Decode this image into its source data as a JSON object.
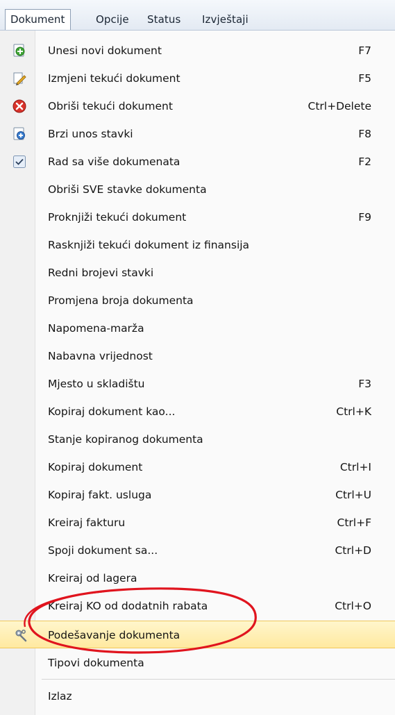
{
  "menubar": {
    "items": [
      {
        "label": "Dokument",
        "active": true
      },
      {
        "label": "Opcije",
        "active": false
      },
      {
        "label": "Status",
        "active": false
      },
      {
        "label": "Izvještaji",
        "active": false
      }
    ]
  },
  "menu": {
    "items": [
      {
        "label": "Unesi novi dokument",
        "shortcut": "F7",
        "icon": "add-document-icon"
      },
      {
        "label": "Izmjeni tekući dokument",
        "shortcut": "F5",
        "icon": "edit-pencil-icon"
      },
      {
        "label": "Obriši tekući dokument",
        "shortcut": "Ctrl+Delete",
        "icon": "delete-red-x-icon"
      },
      {
        "label": "Brzi unos stavki",
        "shortcut": "F8",
        "icon": "quick-add-document-icon"
      },
      {
        "label": "Rad sa više dokumenata",
        "shortcut": "F2",
        "icon": "checkmark-icon"
      },
      {
        "label": "Obriši SVE stavke dokumenta",
        "shortcut": ""
      },
      {
        "label": "Proknjiži tekući dokument",
        "shortcut": "F9"
      },
      {
        "label": "Rasknjiži tekući dokument iz finansija",
        "shortcut": ""
      },
      {
        "label": "Redni brojevi stavki",
        "shortcut": ""
      },
      {
        "label": "Promjena broja dokumenta",
        "shortcut": ""
      },
      {
        "label": "Napomena-marža",
        "shortcut": ""
      },
      {
        "label": "Nabavna vrijednost",
        "shortcut": ""
      },
      {
        "label": "Mjesto u skladištu",
        "shortcut": "F3"
      },
      {
        "label": "Kopiraj dokument kao...",
        "shortcut": "Ctrl+K"
      },
      {
        "label": "Stanje kopiranog dokumenta",
        "shortcut": ""
      },
      {
        "label": "Kopiraj dokument",
        "shortcut": "Ctrl+I"
      },
      {
        "label": "Kopiraj fakt. usluga",
        "shortcut": "Ctrl+U"
      },
      {
        "label": "Kreiraj fakturu",
        "shortcut": "Ctrl+F"
      },
      {
        "label": "Spoji dokument sa...",
        "shortcut": "Ctrl+D"
      },
      {
        "label": "Kreiraj od lagera",
        "shortcut": ""
      },
      {
        "label": "Kreiraj KO od dodatnih rabata",
        "shortcut": "Ctrl+O"
      },
      {
        "label": "Podešavanje dokumenta",
        "shortcut": "",
        "icon": "settings-tools-icon",
        "highlighted": true
      },
      {
        "label": "Tipovi dokumenta",
        "shortcut": ""
      },
      {
        "label": "Izlaz",
        "shortcut": ""
      }
    ]
  },
  "colors": {
    "highlight": "#ffe9a0",
    "annotation_ellipse": "#e0141e",
    "gutter": "#f1f1f1"
  }
}
